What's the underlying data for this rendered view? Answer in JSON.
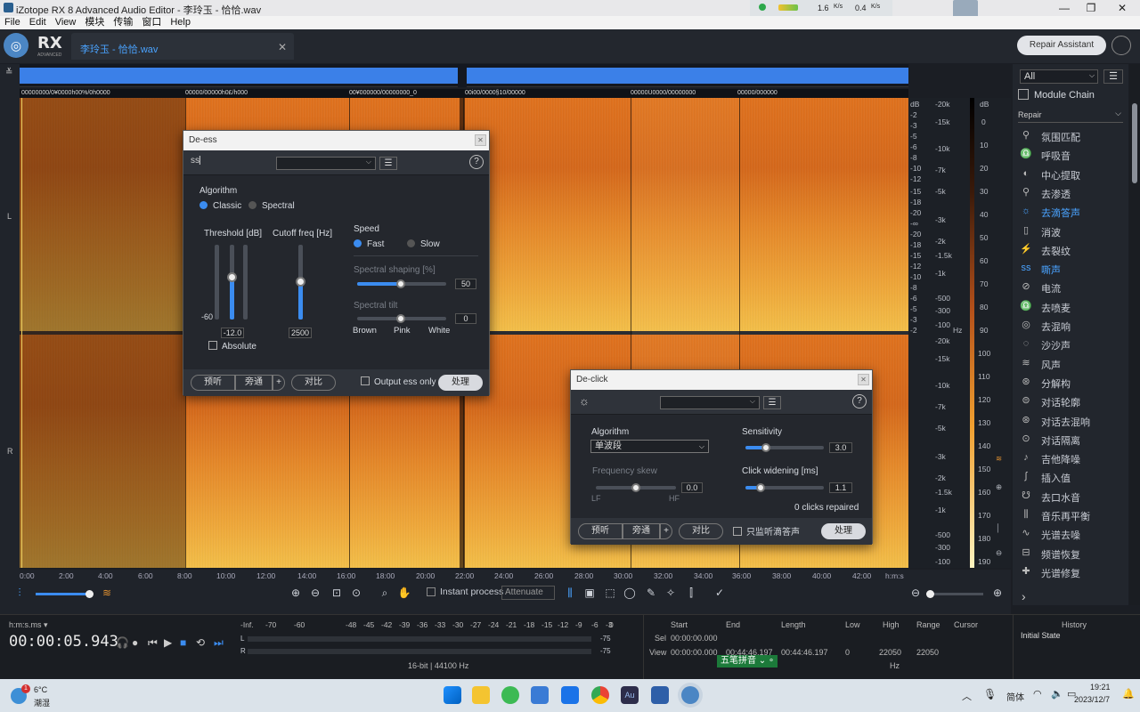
{
  "window": {
    "title": "iZotope RX 8 Advanced Audio Editor - 李玲玉 - 恰恰.wav",
    "net_up": "1.6",
    "net_down": "0.4",
    "net_unit": "K/s"
  },
  "menu": [
    "File",
    "Edit",
    "View",
    "模块",
    "传输",
    "窗口",
    "Help"
  ],
  "header": {
    "brand": "RX",
    "brand_sub": "ADVANCED",
    "file_tab": "李玲玉 - 恰恰.wav",
    "repair_assistant": "Repair Assistant"
  },
  "channels": {
    "left": "L",
    "right": "R"
  },
  "markers": [
    "00000000/0¥0000h00%/0h0000",
    "00000/00000h0£/h000",
    "00¥000000/00000000_0",
    "00i00/0000§10/00000",
    "00000Ü0000/00000000",
    "00000/000000"
  ],
  "scales": {
    "db_label": "dB",
    "hz_label": "Hz",
    "db_ticks_left": [
      "-2",
      "-3",
      "-5",
      "-6",
      "-8",
      "-10",
      "-12",
      "-15",
      "-18",
      "-20",
      "-∞",
      "-20",
      "-18",
      "-15",
      "-12",
      "-10",
      "-8",
      "-6",
      "-5",
      "-3",
      "-2"
    ],
    "hz_ticks": [
      "-20k",
      "-15k",
      "-10k",
      "-7k",
      "-5k",
      "-3k",
      "-2k",
      "-1.5k",
      "-1k",
      "-500",
      "-300",
      "-100"
    ],
    "db_right": [
      "0",
      "10",
      "20",
      "30",
      "40",
      "50",
      "60",
      "70",
      "80",
      "90",
      "100",
      "110",
      "120",
      "130",
      "140",
      "150",
      "160",
      "170",
      "180",
      "190"
    ]
  },
  "right_panel": {
    "filter": "All",
    "module_chain": "Module Chain",
    "category": "Repair",
    "modules": [
      {
        "icon": "ambience-icon",
        "label": "氛围匹配",
        "active": false
      },
      {
        "icon": "breath-icon",
        "label": "呼吸音",
        "active": false
      },
      {
        "icon": "center-icon",
        "label": "中心提取",
        "active": false
      },
      {
        "icon": "bleed-icon",
        "label": "去渗透",
        "active": false
      },
      {
        "icon": "declick-icon",
        "label": "去滴答声",
        "active": true
      },
      {
        "icon": "dewind-icon",
        "label": "消波",
        "active": false
      },
      {
        "icon": "decrackle-icon",
        "label": "去裂纹",
        "active": false
      },
      {
        "icon": "deess-icon",
        "label": "嘶声",
        "active": true
      },
      {
        "icon": "dehum-icon",
        "label": "电流",
        "active": false
      },
      {
        "icon": "deplosive-icon",
        "label": "去喷麦",
        "active": false
      },
      {
        "icon": "dereverb-icon",
        "label": "去混响",
        "active": false
      },
      {
        "icon": "denoise-icon",
        "label": "沙沙声",
        "active": false
      },
      {
        "icon": "wind-icon",
        "label": "风声",
        "active": false
      },
      {
        "icon": "deconstruct-icon",
        "label": "分解构",
        "active": false
      },
      {
        "icon": "dialogue-contour-icon",
        "label": "对话轮廓",
        "active": false
      },
      {
        "icon": "dialogue-dereverb-icon",
        "label": "对话去混响",
        "active": false
      },
      {
        "icon": "dialogue-isolate-icon",
        "label": "对话隔离",
        "active": false
      },
      {
        "icon": "guitar-icon",
        "label": "吉他降噪",
        "active": false
      },
      {
        "icon": "interpolate-icon",
        "label": "插入值",
        "active": false
      },
      {
        "icon": "mouth-icon",
        "label": "去口水音",
        "active": false
      },
      {
        "icon": "rebalance-icon",
        "label": "音乐再平衡",
        "active": false
      },
      {
        "icon": "spectral-denoise-icon",
        "label": "光谱去噪",
        "active": false
      },
      {
        "icon": "spectral-recovery-icon",
        "label": "频谱恢复",
        "active": false
      },
      {
        "icon": "spectral-repair-icon",
        "label": "光谱修复",
        "active": false
      }
    ]
  },
  "timeline": [
    "0:00",
    "2:00",
    "4:00",
    "6:00",
    "8:00",
    "10:00",
    "12:00",
    "14:00",
    "16:00",
    "18:00",
    "20:00",
    "22:00",
    "24:00",
    "26:00",
    "28:00",
    "30:00",
    "32:00",
    "34:00",
    "36:00",
    "38:00",
    "40:00",
    "42:00",
    "h:m:s"
  ],
  "toolbar": {
    "instant_process": "Instant process",
    "attenuate": "Attenuate"
  },
  "transport": {
    "time_format": "h:m:s.ms",
    "timecode": "00:00:05.943"
  },
  "meter": {
    "labels": [
      "-Inf.",
      "-70",
      "-60",
      "-48",
      "-45",
      "-42",
      "-39",
      "-36",
      "-33",
      "-30",
      "-27",
      "-24",
      "-21",
      "-18",
      "-15",
      "-12",
      "-9",
      "-6",
      "-3",
      "0"
    ],
    "l": "L",
    "r": "R",
    "l_peak": "-75",
    "r_peak": "-75",
    "format": "16-bit | 44100 Hz"
  },
  "selection": {
    "start_h": "Start",
    "end_h": "End",
    "length_h": "Length",
    "low_h": "Low",
    "high_h": "High",
    "range_h": "Range",
    "cursor_h": "Cursor",
    "sel_label": "Sel",
    "view_label": "View",
    "sel_start": "00:00:00.000",
    "view_start": "00:00:00.000",
    "view_end": "00:44:46.197",
    "view_length": "00:44:46.197",
    "low": "0",
    "high": "22050",
    "range": "22050",
    "hz": "Hz",
    "ime": "五笔拼音"
  },
  "history": {
    "title": "History",
    "item": "Initial State"
  },
  "deess": {
    "title": "De-ess",
    "algorithm": "Algorithm",
    "classic": "Classic",
    "spectral": "Spectral",
    "threshold_label": "Threshold [dB]",
    "threshold_min": "-60",
    "threshold_value": "-12.0",
    "absolute": "Absolute",
    "cutoff_label": "Cutoff freq [Hz]",
    "cutoff_value": "2500",
    "speed": "Speed",
    "fast": "Fast",
    "slow": "Slow",
    "shaping_label": "Spectral shaping [%]",
    "shaping_value": "50",
    "tilt_label": "Spectral tilt",
    "tilt_value": "0",
    "brown": "Brown",
    "pink": "Pink",
    "white": "White",
    "preview": "预听",
    "bypass": "旁通",
    "plus": "+",
    "compare": "对比",
    "output_only": "Output ess only",
    "process": "处理"
  },
  "declick": {
    "title": "De-click",
    "algorithm": "Algorithm",
    "algorithm_value": "单波段",
    "freq_skew": "Frequency skew",
    "freq_skew_value": "0.0",
    "lf": "LF",
    "hf": "HF",
    "sensitivity": "Sensitivity",
    "sensitivity_value": "3.0",
    "widening": "Click widening [ms]",
    "widening_value": "1.1",
    "repaired": "0 clicks repaired",
    "preview": "预听",
    "bypass": "旁通",
    "plus": "+",
    "compare": "对比",
    "monitor": "只监听滴答声",
    "process": "处理"
  },
  "taskbar": {
    "temp": "6°C",
    "weather": "潮湿",
    "badge": "1",
    "lang": "简体",
    "time": "19:21",
    "date": "2023/12/7"
  }
}
